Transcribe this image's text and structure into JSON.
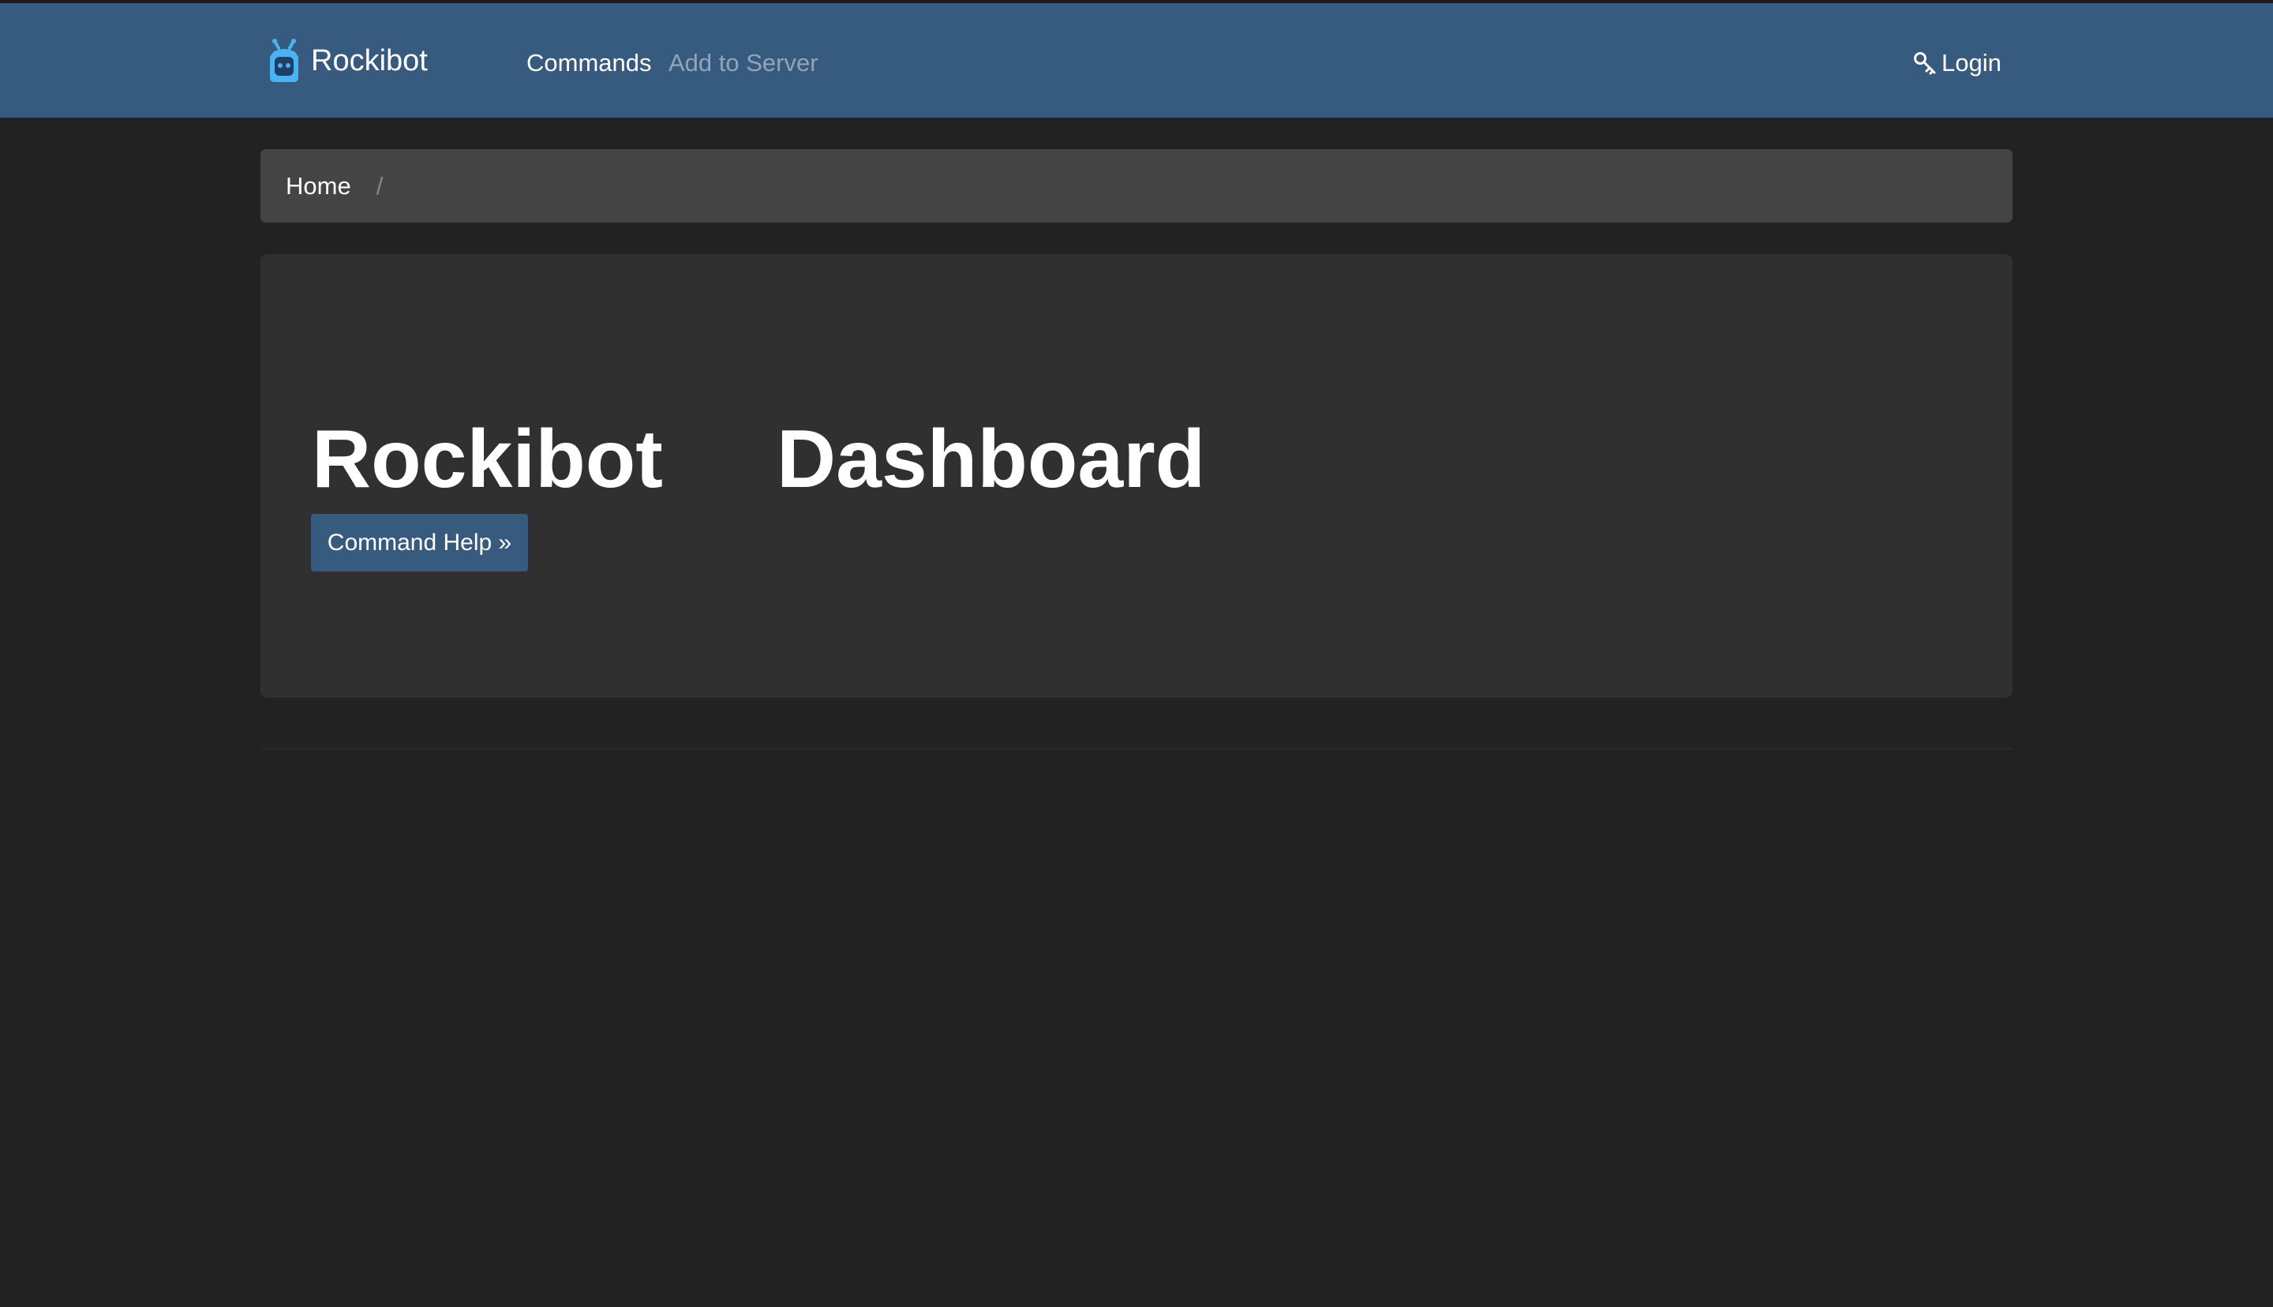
{
  "navbar": {
    "brand": "Rockibot",
    "brand_icon": "robot-icon",
    "links": [
      "Commands",
      "Add to Server"
    ],
    "login_label": "Login",
    "login_icon": "key-icon",
    "colors": {
      "background": "#375a7f",
      "icon": "#4ab3f4"
    }
  },
  "breadcrumb": {
    "home": "Home",
    "separator": "/"
  },
  "jumbotron": {
    "title_left": "Rockibot",
    "title_right": "Dashboard",
    "button_label": "Command Help »"
  }
}
